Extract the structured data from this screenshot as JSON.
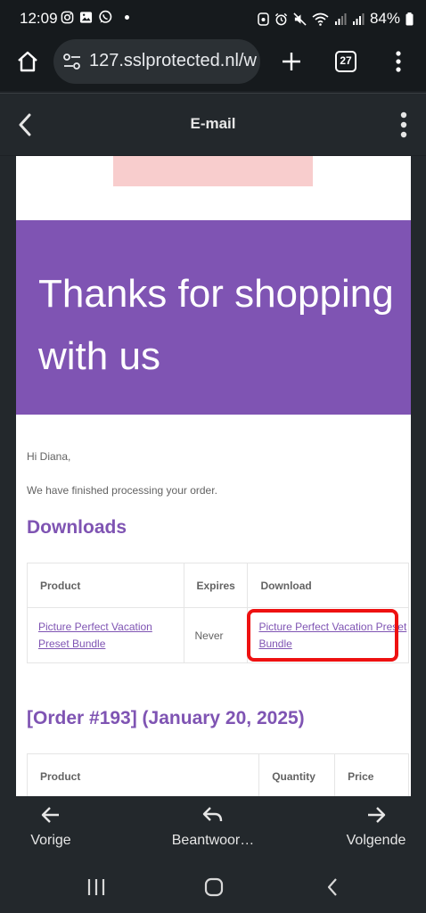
{
  "status_bar": {
    "time": "12:09",
    "battery": "84%"
  },
  "browser": {
    "url": "127.sslprotected.nl/w",
    "tab_count": "27"
  },
  "app_bar": {
    "title": "E-mail"
  },
  "email": {
    "banner_title": "Thanks for shopping with us",
    "greeting": "Hi Diana,",
    "message": "We have finished processing your order.",
    "downloads_heading": "Downloads",
    "downloads_table": {
      "headers": [
        "Product",
        "Expires",
        "Download"
      ],
      "rows": [
        {
          "product": "Picture Perfect Vacation Preset Bundle",
          "expires": "Never",
          "download": "Picture Perfect Vacation Preset Bundle"
        }
      ]
    },
    "order_heading": "[Order #193] (January 20, 2025)",
    "order_table": {
      "headers": [
        "Product",
        "Quantity",
        "Price"
      ]
    }
  },
  "bottom_bar": {
    "prev": "Vorige",
    "reply": "Beantwoor…",
    "next": "Volgende"
  }
}
